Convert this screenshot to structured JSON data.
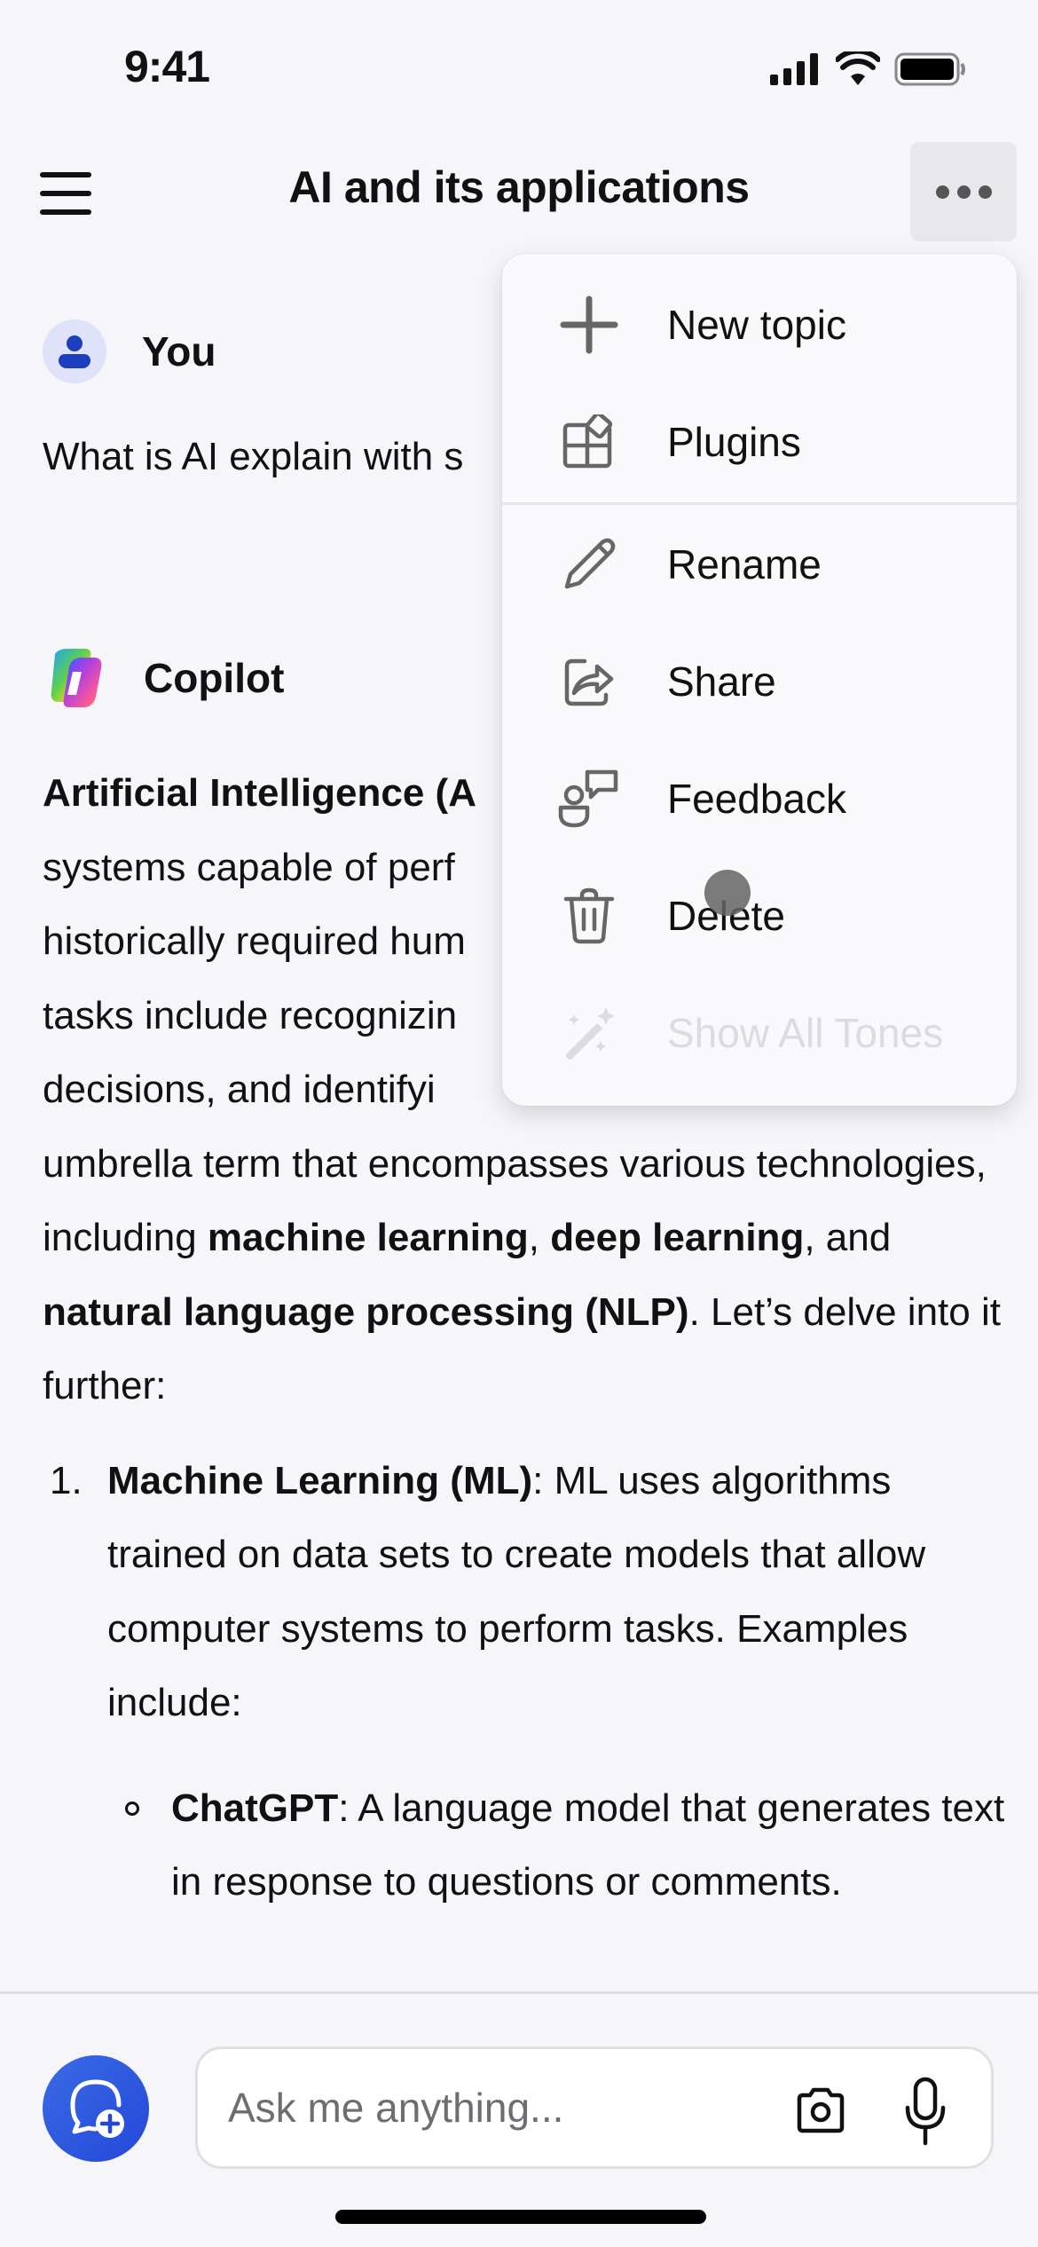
{
  "status_bar": {
    "time": "9:41"
  },
  "nav": {
    "title": "AI and its applications"
  },
  "chat": {
    "user": {
      "name": "You",
      "message": "What is AI explain with s"
    },
    "assistant": {
      "name": "Copilot",
      "intro": {
        "bold_1": "Artificial Intelligence (A",
        "text_1": "systems capable of perf",
        "text_2": "historically required hum",
        "text_3": "tasks include recognizin",
        "text_4": "decisions, and identifyi",
        "text_5": "umbrella term that encompasses various technologies, including ",
        "bold_ml": "machine learning",
        "comma_1": ", ",
        "bold_dl": "deep learning",
        "and": ", and ",
        "bold_nlp": "natural language processing (NLP)",
        "tail": ". Let’s delve into it further:"
      },
      "list": [
        {
          "number": "1.",
          "title": "Machine Learning (ML)",
          "text": ": ML uses algorithms trained on data sets to create models that allow computer systems to perform tasks. Examples include:",
          "subitems": [
            {
              "title": "ChatGPT",
              "text": ": A language model that generates text in response to questions or comments."
            }
          ]
        }
      ]
    }
  },
  "dropdown": {
    "items": [
      {
        "label": "New topic",
        "icon": "plus-icon",
        "enabled": true
      },
      {
        "label": "Plugins",
        "icon": "plugins-icon",
        "enabled": true
      },
      {
        "label": "Rename",
        "icon": "pencil-icon",
        "enabled": true
      },
      {
        "label": "Share",
        "icon": "share-icon",
        "enabled": true
      },
      {
        "label": "Feedback",
        "icon": "feedback-icon",
        "enabled": true
      },
      {
        "label": "Delete",
        "icon": "trash-icon",
        "enabled": true
      },
      {
        "label": "Show All Tones",
        "icon": "magic-wand-icon",
        "enabled": false
      }
    ]
  },
  "composer": {
    "placeholder": "Ask me anything...",
    "value": ""
  },
  "colors": {
    "accent": "#2447d8",
    "background": "#f6f5f9",
    "menu_background": "#f9f8fb",
    "icon_gray": "#666666",
    "disabled_text": "#dcdbe0"
  }
}
